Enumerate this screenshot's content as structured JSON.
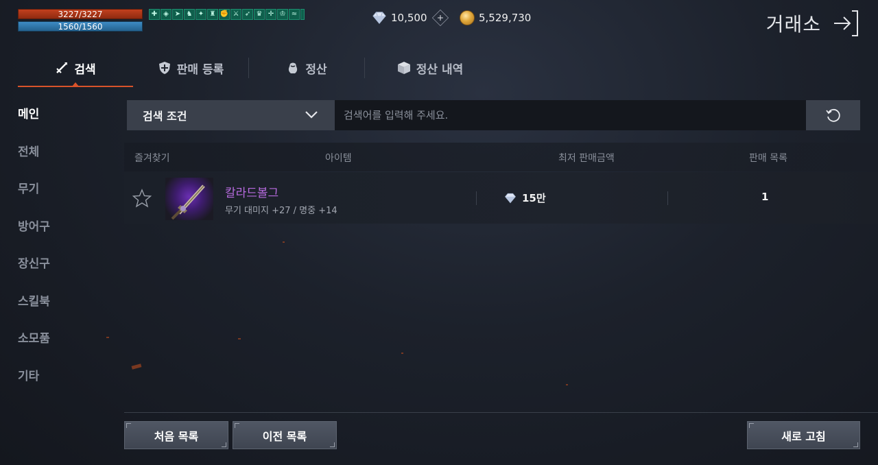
{
  "status": {
    "hp": "3227/3227",
    "mp": "1560/1560",
    "buff_icons": [
      "shield-buff",
      "potion-buff",
      "haste-buff",
      "guard-buff",
      "wing-buff",
      "armor-buff",
      "strength-buff",
      "sword-buff",
      "bow-buff",
      "helmet-buff",
      "plus-buff",
      "crown-buff",
      "fish-buff",
      "extra-buff"
    ]
  },
  "currency": {
    "diamond": "10,500",
    "gold": "5,529,730"
  },
  "header": {
    "title": "거래소"
  },
  "tabs": [
    {
      "label": "검색",
      "icon": "sword-icon",
      "active": true
    },
    {
      "label": "판매 등록",
      "icon": "shield-plus-icon",
      "active": false
    },
    {
      "label": "정산",
      "icon": "pouch-icon",
      "active": false
    },
    {
      "label": "정산 내역",
      "icon": "box-icon",
      "active": false
    }
  ],
  "sidebar": {
    "items": [
      {
        "label": "메인",
        "active": true
      },
      {
        "label": "전체"
      },
      {
        "label": "무기"
      },
      {
        "label": "방어구"
      },
      {
        "label": "장신구"
      },
      {
        "label": "스킬북"
      },
      {
        "label": "소모품"
      },
      {
        "label": "기타"
      }
    ]
  },
  "search": {
    "filter_label": "검색 조건",
    "placeholder": "검색어를 입력해 주세요.",
    "value": ""
  },
  "table": {
    "headers": {
      "favorite": "즐겨찾기",
      "item": "아이템",
      "price": "최저 판매금액",
      "listings": "판매 목록"
    },
    "rows": [
      {
        "favorite": false,
        "name": "칼라드볼그",
        "desc": "무기 대미지 +27 / 명중 +14",
        "price": "15만",
        "listings": "1"
      }
    ]
  },
  "buttons": {
    "first": "처음 목록",
    "prev": "이전 목록",
    "refresh": "새로 고침"
  },
  "colors": {
    "accent": "#d9532a",
    "item_name": "#b86be0",
    "hp": "#c2401e",
    "mp": "#3d8bc4"
  }
}
